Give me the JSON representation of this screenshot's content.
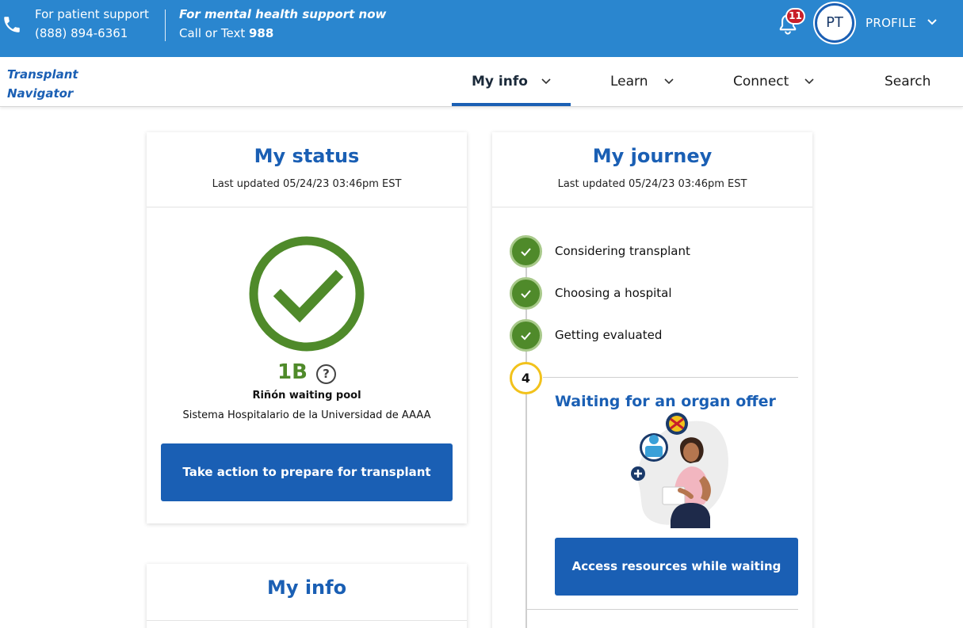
{
  "topbar": {
    "support_label": "For patient support",
    "support_phone": "(888) 894-6361",
    "mh_label": "For mental health support now",
    "mh_prefix": "Call or Text ",
    "mh_number": "988",
    "notification_count": "11",
    "avatar_initials": "PT",
    "profile_label": "PROFILE",
    "color": "#2a86cf"
  },
  "nav": {
    "logo_line1": "Transplant",
    "logo_line2": "Navigator",
    "items": [
      {
        "label": "My info"
      },
      {
        "label": "Learn"
      },
      {
        "label": "Connect"
      },
      {
        "label": "Search"
      }
    ],
    "active": "My info"
  },
  "status_card": {
    "title": "My status",
    "updated": "Last updated 05/24/23 03:46pm EST",
    "tier": "1B",
    "help": "?",
    "pool": "Riñón waiting pool",
    "hospital": "Sistema Hospitalario de la Universidad de AAAA",
    "button": "Take action to prepare for transplant"
  },
  "info_card": {
    "title": "My info"
  },
  "journey_card": {
    "title": "My journey",
    "updated": "Last updated 05/24/23 03:46pm EST",
    "steps": [
      {
        "label": "Considering transplant",
        "status": "complete"
      },
      {
        "label": "Choosing a hospital",
        "status": "complete"
      },
      {
        "label": "Getting evaluated",
        "status": "complete"
      },
      {
        "number": "4",
        "label": "Waiting for an organ offer",
        "status": "current"
      }
    ],
    "button": "Access resources while waiting"
  },
  "colors": {
    "brand_blue": "#1a5fb4",
    "success_green": "#4f8a2a",
    "current_yellow": "#f2c21b",
    "badge_red": "#c8202a"
  }
}
